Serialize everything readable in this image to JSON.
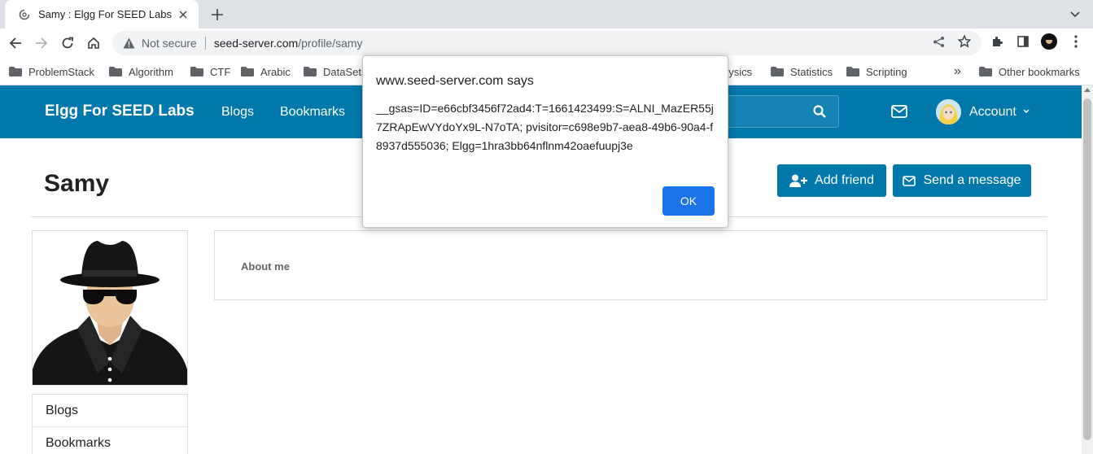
{
  "browser": {
    "tab_title": "Samy : Elgg For SEED Labs",
    "omnibox": {
      "security_label": "Not secure",
      "host": "seed-server.com",
      "path": "/profile/samy"
    },
    "bookmarks": [
      {
        "label": "ProblemStack"
      },
      {
        "label": "Algorithm"
      },
      {
        "label": "CTF"
      },
      {
        "label": "Arabic"
      },
      {
        "label": "DataSets"
      },
      {
        "label": "hysics"
      },
      {
        "label": "Statistics"
      },
      {
        "label": "Scripting"
      }
    ],
    "other_bookmarks": "Other bookmarks",
    "overflow_glyph": "»"
  },
  "site": {
    "brand": "Elgg For SEED Labs",
    "nav": [
      "Blogs",
      "Bookmarks"
    ],
    "account_label": "Account"
  },
  "profile": {
    "name": "Samy",
    "add_friend_label": "Add friend",
    "send_message_label": "Send a message",
    "about_label": "About me",
    "menu": [
      "Blogs",
      "Bookmarks"
    ]
  },
  "alert": {
    "title": "www.seed-server.com says",
    "message": "__gsas=ID=e66cbf3456f72ad4:T=1661423499:S=ALNI_MazER55j7ZRApEwVYdoYx9L-N7oTA; pvisitor=c698e9b7-aea8-49b6-90a4-f8937d555036; Elgg=1hra3bb64nflnm42oaefuupj3e",
    "ok_label": "OK"
  },
  "colors": {
    "elgg_blue": "#0078ac",
    "dialog_button": "#1a73e8"
  }
}
